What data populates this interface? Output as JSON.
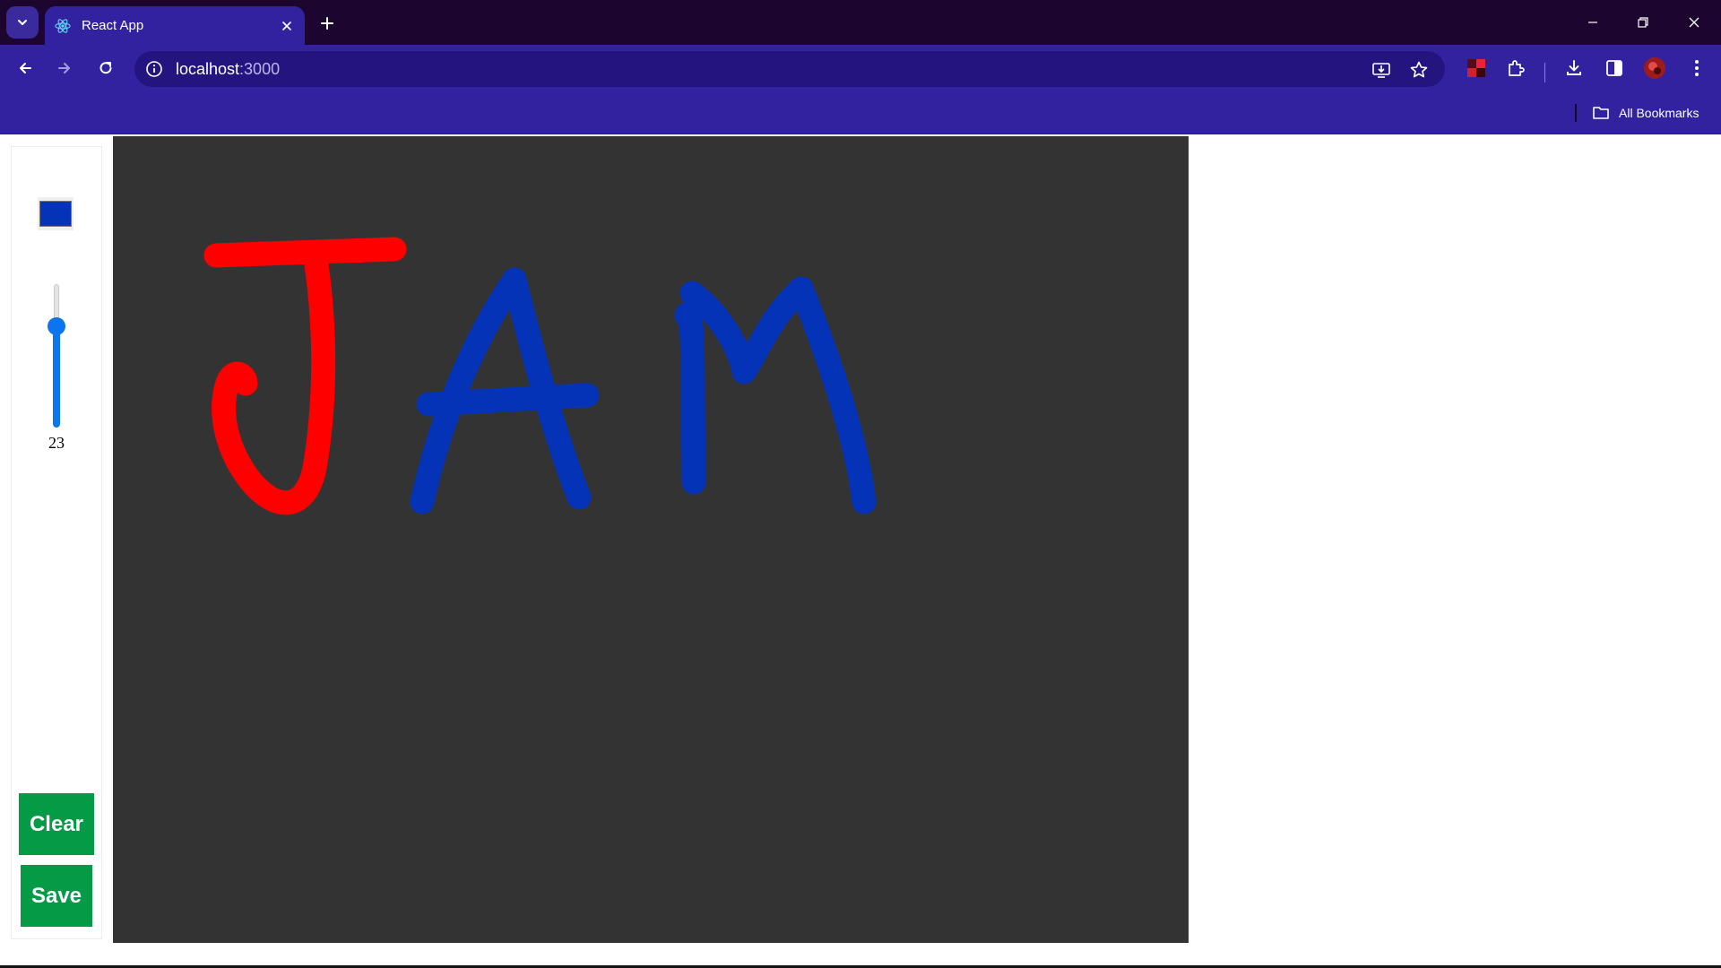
{
  "browser": {
    "tab": {
      "title": "React App",
      "favicon": "react-icon"
    },
    "address": {
      "host": "localhost",
      "port": ":3000"
    },
    "bookmarks": {
      "all_label": "All Bookmarks"
    }
  },
  "app": {
    "color_picker": {
      "value": "#0433b8"
    },
    "brush_size": {
      "value": "23",
      "min": 1,
      "max": 100
    },
    "buttons": {
      "clear": "Clear",
      "save": "Save"
    },
    "canvas": {
      "background": "#333333",
      "strokes": [
        {
          "color": "#ff0000",
          "letter": "J"
        },
        {
          "color": "#0433b8",
          "letter": "A"
        },
        {
          "color": "#0433b8",
          "letter": "M"
        }
      ]
    }
  },
  "colors": {
    "titlebar": "#1c0630",
    "toolbar": "#3222a0",
    "button_green": "#049a46",
    "slider_blue": "#0a75ec"
  }
}
